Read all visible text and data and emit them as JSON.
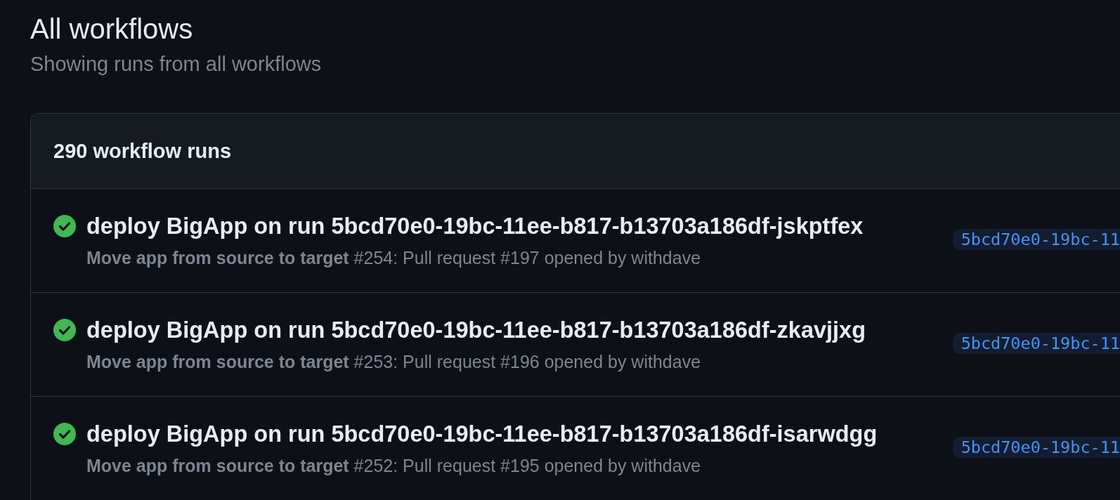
{
  "page": {
    "title": "All workflows",
    "subtitle": "Showing runs from all workflows"
  },
  "runs_list": {
    "header": "290 workflow runs",
    "runs": [
      {
        "kind": "success",
        "title": "deploy BigApp on run 5bcd70e0-19bc-11ee-b817-b13703a186df-jskptfex",
        "description": "**Move app from source to target** #254: Pull request #197 opened by withdave",
        "branch": "5bcd70e0-19bc-11"
      },
      {
        "kind": "success",
        "title": "deploy BigApp on run 5bcd70e0-19bc-11ee-b817-b13703a186df-zkavjjxg",
        "description": "**Move app from source to target** #253: Pull request #196 opened by withdave",
        "branch": "5bcd70e0-19bc-11"
      },
      {
        "kind": "success",
        "title": "deploy BigApp on run 5bcd70e0-19bc-11ee-b817-b13703a186df-isarwdgg",
        "description": "**Move app from source to target** #252: Pull request #195 opened by withdave",
        "branch": "5bcd70e0-19bc-11"
      }
    ]
  }
}
